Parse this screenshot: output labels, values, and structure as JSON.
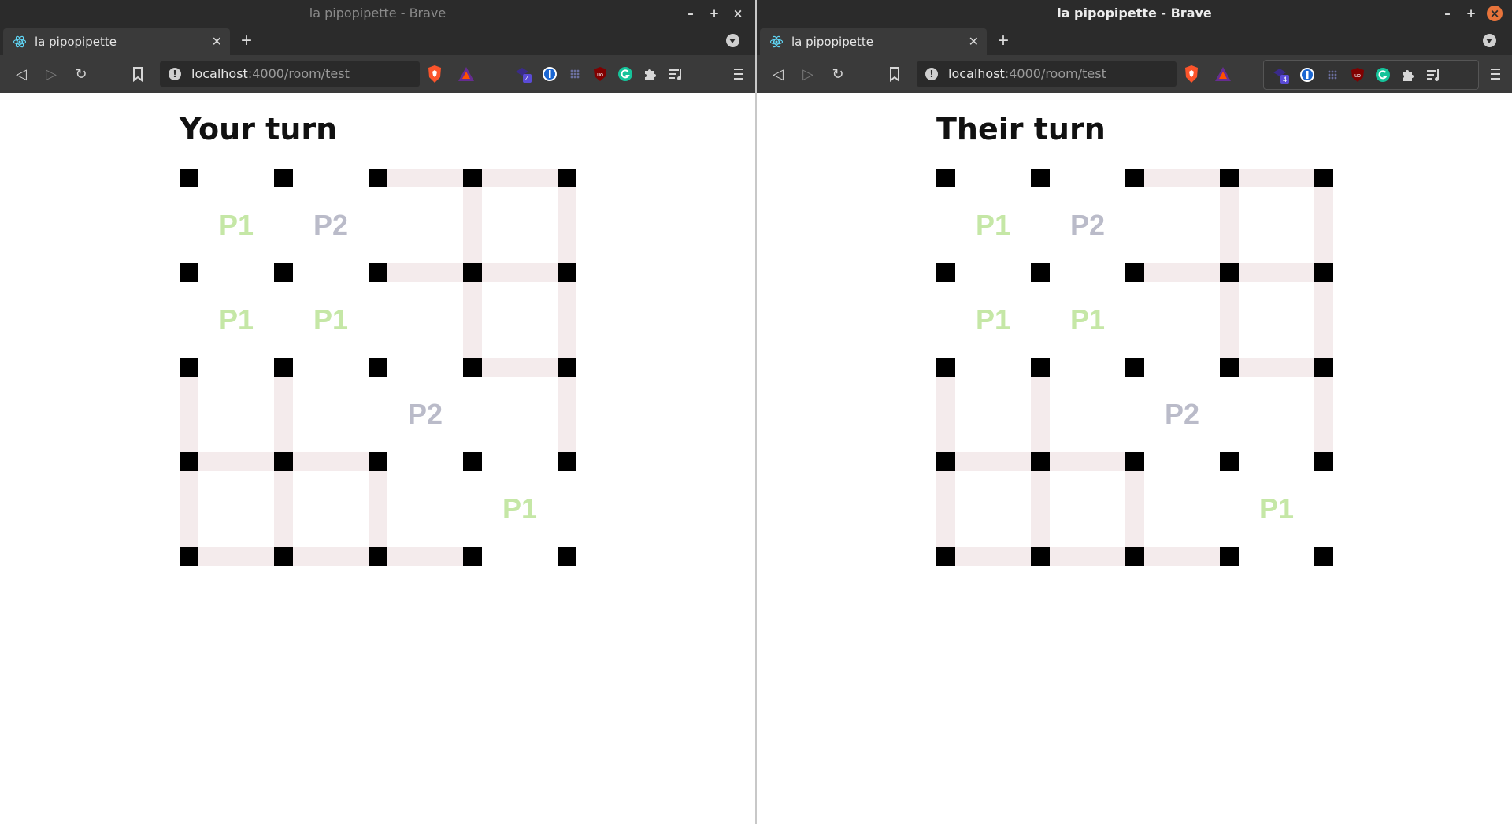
{
  "windows": [
    {
      "title": "la pipopipette - Brave",
      "tab_title": "la pipopipette",
      "url_host": "localhost",
      "url_path": ":4000/room/test",
      "heading": "Your turn",
      "extension_badge": "4"
    },
    {
      "title": "la pipopipette - Brave",
      "tab_title": "la pipopipette",
      "url_host": "localhost",
      "url_path": ":4000/room/test",
      "heading": "Their turn",
      "extension_badge": "4"
    }
  ],
  "board": {
    "size": 4,
    "colors": {
      "empty": "#f4ebec",
      "p1": "#c5e7a6",
      "p2": "#babbc9",
      "dot": "#000000"
    },
    "h_edges": [
      [
        "p1",
        "p1",
        "e",
        "e"
      ],
      [
        "p1",
        "p2",
        "e",
        "e"
      ],
      [
        "p1",
        "p1",
        "p1",
        "e"
      ],
      [
        "e",
        "e",
        "p1",
        "p2"
      ],
      [
        "e",
        "e",
        "e",
        "p1"
      ]
    ],
    "v_edges": [
      [
        "p2",
        "p2",
        "p1",
        "e",
        "e"
      ],
      [
        "p2",
        "p1",
        "p2",
        "e",
        "e"
      ],
      [
        "e",
        "e",
        "p2",
        "p2",
        "e"
      ],
      [
        "e",
        "e",
        "e",
        "p1",
        "p2"
      ]
    ],
    "cells": [
      [
        "P1",
        "P2",
        "",
        ""
      ],
      [
        "P1",
        "P1",
        "",
        ""
      ],
      [
        "",
        "",
        "P2",
        ""
      ],
      [
        "",
        "",
        "",
        "P1"
      ]
    ]
  }
}
